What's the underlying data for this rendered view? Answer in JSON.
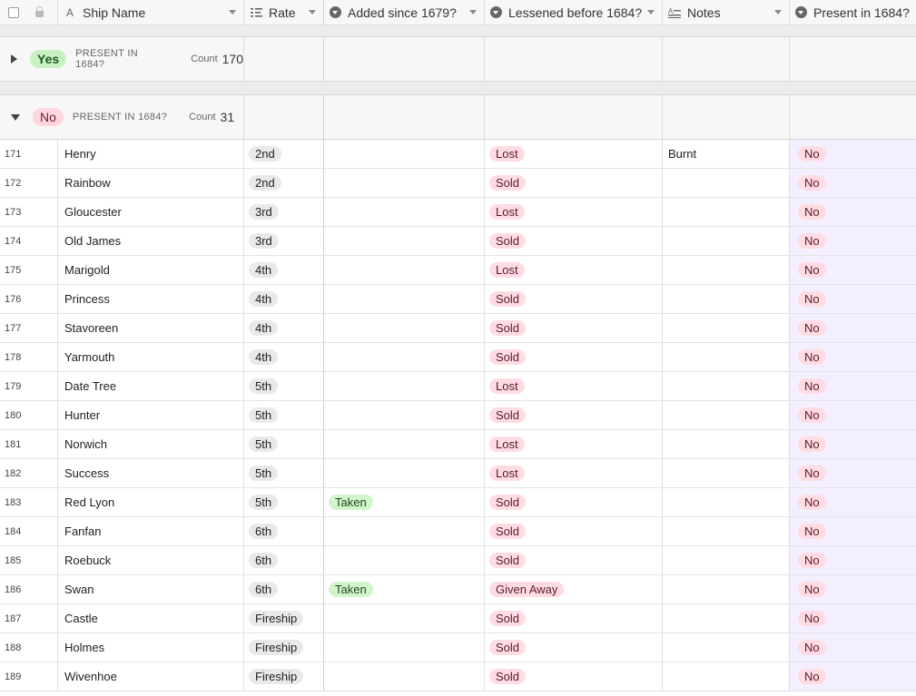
{
  "header": {
    "columns": [
      {
        "label": "Ship Name",
        "icon": "text-field-icon"
      },
      {
        "label": "Rate",
        "icon": "rating-field-icon"
      },
      {
        "label": "Added since 1679?",
        "icon": "single-select-icon"
      },
      {
        "label": "Lessened before 1684?",
        "icon": "single-select-icon"
      },
      {
        "label": "Notes",
        "icon": "long-text-icon"
      },
      {
        "label": "Present in 1684?",
        "icon": "single-select-icon"
      }
    ]
  },
  "groups": [
    {
      "value": "Yes",
      "field": "PRESENT IN 1684?",
      "count_label": "Count",
      "count": "170",
      "expanded": false
    },
    {
      "value": "No",
      "field": "PRESENT IN 1684?",
      "count_label": "Count",
      "count": "31",
      "expanded": true
    }
  ],
  "rows": [
    {
      "num": "171",
      "name": "Henry",
      "rate": "2nd",
      "added": "",
      "lessened": "Lost",
      "notes": "Burnt",
      "present": "No"
    },
    {
      "num": "172",
      "name": "Rainbow",
      "rate": "2nd",
      "added": "",
      "lessened": "Sold",
      "notes": "",
      "present": "No"
    },
    {
      "num": "173",
      "name": "Gloucester",
      "rate": "3rd",
      "added": "",
      "lessened": "Lost",
      "notes": "",
      "present": "No"
    },
    {
      "num": "174",
      "name": "Old James",
      "rate": "3rd",
      "added": "",
      "lessened": "Sold",
      "notes": "",
      "present": "No"
    },
    {
      "num": "175",
      "name": "Marigold",
      "rate": "4th",
      "added": "",
      "lessened": "Lost",
      "notes": "",
      "present": "No"
    },
    {
      "num": "176",
      "name": "Princess",
      "rate": "4th",
      "added": "",
      "lessened": "Sold",
      "notes": "",
      "present": "No"
    },
    {
      "num": "177",
      "name": "Stavoreen",
      "rate": "4th",
      "added": "",
      "lessened": "Sold",
      "notes": "",
      "present": "No"
    },
    {
      "num": "178",
      "name": "Yarmouth",
      "rate": "4th",
      "added": "",
      "lessened": "Sold",
      "notes": "",
      "present": "No"
    },
    {
      "num": "179",
      "name": "Date Tree",
      "rate": "5th",
      "added": "",
      "lessened": "Lost",
      "notes": "",
      "present": "No"
    },
    {
      "num": "180",
      "name": "Hunter",
      "rate": "5th",
      "added": "",
      "lessened": "Sold",
      "notes": "",
      "present": "No"
    },
    {
      "num": "181",
      "name": "Norwich",
      "rate": "5th",
      "added": "",
      "lessened": "Lost",
      "notes": "",
      "present": "No"
    },
    {
      "num": "182",
      "name": "Success",
      "rate": "5th",
      "added": "",
      "lessened": "Lost",
      "notes": "",
      "present": "No"
    },
    {
      "num": "183",
      "name": "Red Lyon",
      "rate": "5th",
      "added": "Taken",
      "lessened": "Sold",
      "notes": "",
      "present": "No"
    },
    {
      "num": "184",
      "name": "Fanfan",
      "rate": "6th",
      "added": "",
      "lessened": "Sold",
      "notes": "",
      "present": "No"
    },
    {
      "num": "185",
      "name": "Roebuck",
      "rate": "6th",
      "added": "",
      "lessened": "Sold",
      "notes": "",
      "present": "No"
    },
    {
      "num": "186",
      "name": "Swan",
      "rate": "6th",
      "added": "Taken",
      "lessened": "Given Away",
      "notes": "",
      "present": "No"
    },
    {
      "num": "187",
      "name": "Castle",
      "rate": "Fireship",
      "added": "",
      "lessened": "Sold",
      "notes": "",
      "present": "No"
    },
    {
      "num": "188",
      "name": "Holmes",
      "rate": "Fireship",
      "added": "",
      "lessened": "Sold",
      "notes": "",
      "present": "No"
    },
    {
      "num": "189",
      "name": "Wivenhoe",
      "rate": "Fireship",
      "added": "",
      "lessened": "Sold",
      "notes": "",
      "present": "No"
    }
  ]
}
